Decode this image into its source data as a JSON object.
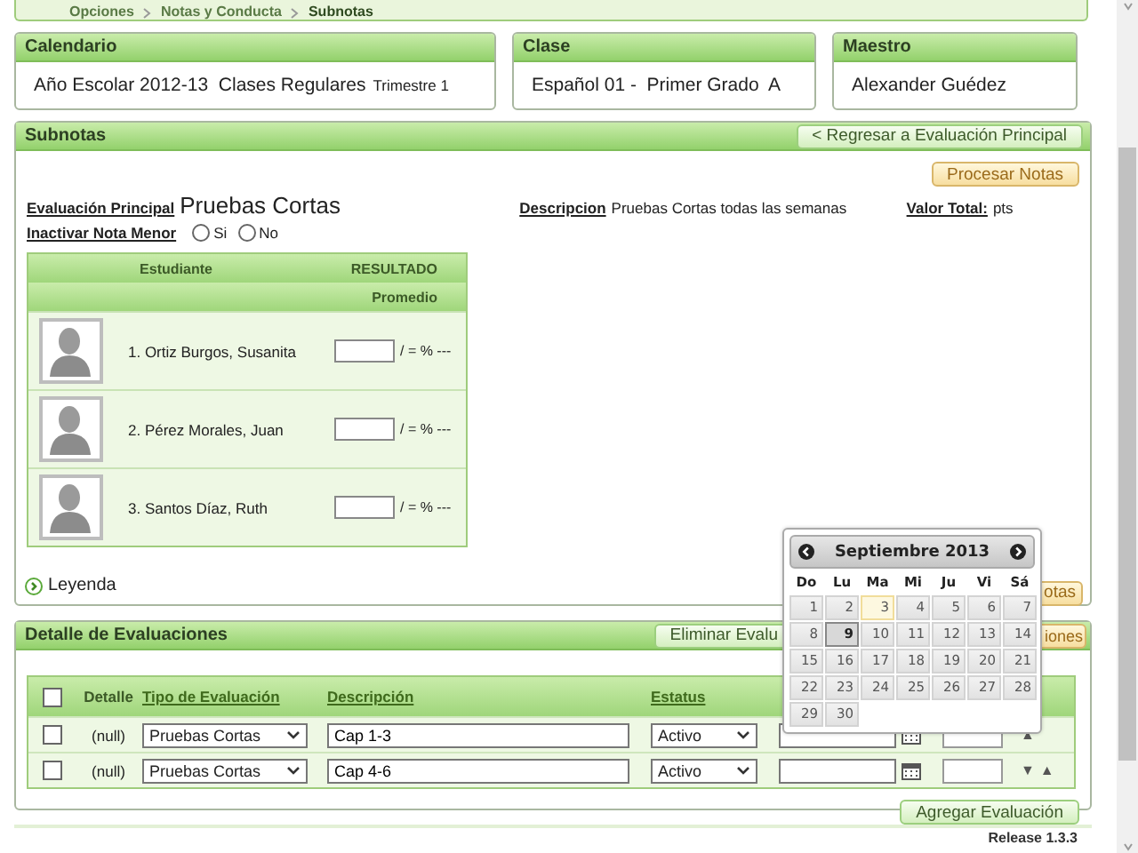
{
  "breadcrumb": [
    "Opciones",
    "Notas y Conducta",
    "Subnotas"
  ],
  "info_cards": [
    {
      "title": "Calendario",
      "value": "Año Escolar 2012-13  Clases Regulares",
      "note": "Trimestre 1"
    },
    {
      "title": "Clase",
      "value": "Español 01 -  Primer Grado  A"
    },
    {
      "title": "Maestro",
      "value": "Alexander Guédez"
    }
  ],
  "subnotas": {
    "title": "Subnotas",
    "back_button": "< Regresar a Evaluación Principal",
    "process_button": "Procesar Notas",
    "main_eval_label": "Evaluación Principal",
    "main_eval_value": "Pruebas Cortas",
    "description_label": "Descripcion",
    "description_value": "Pruebas Cortas todas las semanas",
    "total_label": "Valor Total:",
    "total_value": "pts",
    "inactivate_label": "Inactivar Nota Menor",
    "options": [
      {
        "label": "Si",
        "selected": false
      },
      {
        "label": "No",
        "selected": false
      }
    ],
    "students_table": {
      "columns": [
        "Estudiante",
        "RESULTADO"
      ],
      "subheader": "Promedio",
      "rows": [
        {
          "name": "1. Ortiz Burgos, Susanita",
          "result": "/ = % ---"
        },
        {
          "name": "2. Pérez Morales, Juan",
          "result": "/ = % ---"
        },
        {
          "name": "3. Santos Díaz, Ruth",
          "result": "/ = % ---"
        }
      ]
    },
    "partial_button": "otas",
    "legend": "Leyenda"
  },
  "detail": {
    "title": "Detalle de Evaluaciones",
    "partial_buttons": [
      "Eliminar Evalu",
      "iones"
    ],
    "header_checked": false,
    "columns": [
      "Detalle",
      "Tipo de Evaluación",
      "Descripción",
      "Estatus"
    ],
    "rows": [
      {
        "checked": false,
        "detail": "(null)",
        "type": "Pruebas Cortas",
        "description": "Cap 1-3",
        "status": "Activo",
        "arrows": [
          "▲"
        ]
      },
      {
        "checked": false,
        "detail": "(null)",
        "type": "Pruebas Cortas",
        "description": "Cap 4-6",
        "status": "Activo",
        "arrows": [
          "▼",
          "▲"
        ]
      }
    ],
    "add_button": "Agregar Evaluación"
  },
  "datepicker": {
    "month": "Septiembre 2013",
    "weekdays": [
      "Do",
      "Lu",
      "Ma",
      "Mi",
      "Ju",
      "Vi",
      "Sá"
    ],
    "days": [
      {
        "label": "1",
        "selected": false,
        "today": false
      },
      {
        "label": "2",
        "selected": false,
        "today": false
      },
      {
        "label": "3",
        "selected": false,
        "today": true
      },
      {
        "label": "4",
        "selected": false,
        "today": false
      },
      {
        "label": "5",
        "selected": false,
        "today": false
      },
      {
        "label": "6",
        "selected": false,
        "today": false
      },
      {
        "label": "7",
        "selected": false,
        "today": false
      },
      {
        "label": "8",
        "selected": false,
        "today": false
      },
      {
        "label": "9",
        "selected": true,
        "today": false
      },
      {
        "label": "10",
        "selected": false,
        "today": false
      },
      {
        "label": "11",
        "selected": false,
        "today": false
      },
      {
        "label": "12",
        "selected": false,
        "today": false
      },
      {
        "label": "13",
        "selected": false,
        "today": false
      },
      {
        "label": "14",
        "selected": false,
        "today": false
      },
      {
        "label": "15",
        "selected": false,
        "today": false
      },
      {
        "label": "16",
        "selected": false,
        "today": false
      },
      {
        "label": "17",
        "selected": false,
        "today": false
      },
      {
        "label": "18",
        "selected": false,
        "today": false
      },
      {
        "label": "19",
        "selected": false,
        "today": false
      },
      {
        "label": "20",
        "selected": false,
        "today": false
      },
      {
        "label": "21",
        "selected": false,
        "today": false
      },
      {
        "label": "22",
        "selected": false,
        "today": false
      },
      {
        "label": "23",
        "selected": false,
        "today": false
      },
      {
        "label": "24",
        "selected": false,
        "today": false
      },
      {
        "label": "25",
        "selected": false,
        "today": false
      },
      {
        "label": "26",
        "selected": false,
        "today": false
      },
      {
        "label": "27",
        "selected": false,
        "today": false
      },
      {
        "label": "28",
        "selected": false,
        "today": false
      },
      {
        "label": "29",
        "selected": false,
        "today": false
      },
      {
        "label": "30",
        "selected": false,
        "today": false
      }
    ]
  },
  "footer": {
    "release": "Release 1.3.3"
  }
}
